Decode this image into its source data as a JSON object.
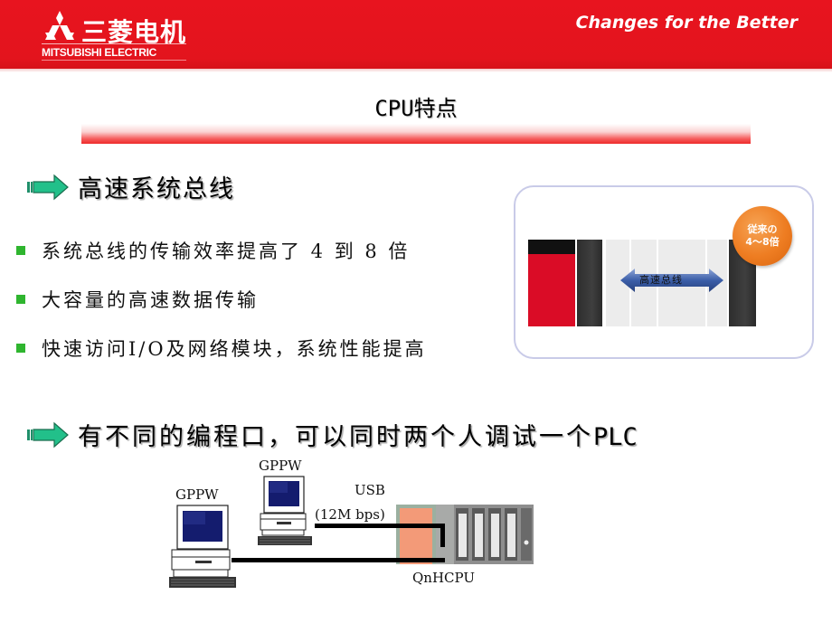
{
  "header": {
    "brand_cn": "三菱电机",
    "brand_en": "MITSUBISHI ELECTRIC",
    "tagline": "Changes for the Better",
    "logo_icon": "three-diamonds-icon",
    "colors": {
      "banner": "#e3141d",
      "text": "#ffffff"
    }
  },
  "slide": {
    "title": "CPU特点"
  },
  "section1": {
    "icon": "green-arrow-icon",
    "heading": "高速系统总线",
    "bullets": [
      {
        "text": "系统总线的传输效率提高了 4 到 8 倍"
      },
      {
        "text": "大容量的高速数据传输"
      },
      {
        "text": "快速访问I/O及网络模块，系统性能提高"
      }
    ],
    "bullet_color": "#2fb52f",
    "diagram": {
      "bus_label": "高速总线",
      "badge_line1": "従来の",
      "badge_line2": "4～8倍",
      "badge_color": "#ee7d22"
    }
  },
  "section2": {
    "icon": "green-arrow-icon",
    "heading": "有不同的编程口，可以同时两个人调试一个",
    "heading_suffix": "PLC",
    "diagram": {
      "pc1_label": "GPPW",
      "pc2_label": "GPPW",
      "usb_label": "USB",
      "usb_speed": "(12M bps)",
      "plc_label": "QnHCPU"
    }
  }
}
